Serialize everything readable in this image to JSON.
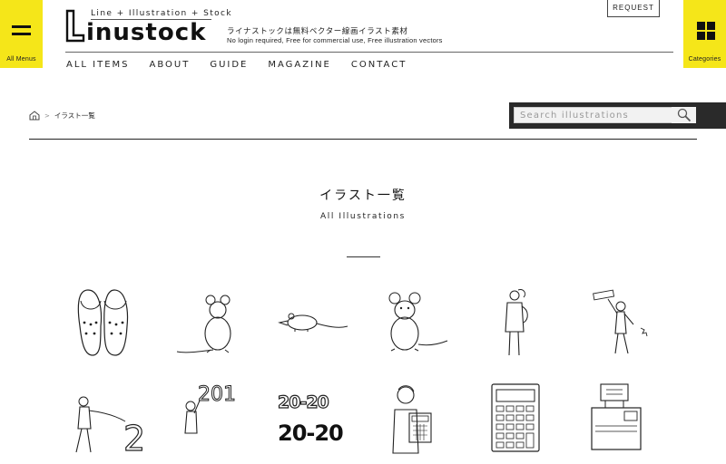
{
  "menus": {
    "left_label": "All Menus",
    "right_label": "Categories"
  },
  "header": {
    "logo_tagline": "Line + Illustration + Stock",
    "logo_word": "inustock",
    "tagline_jp": "ライナストックは無料ベクター線画イラスト素材",
    "tagline_en": "No login required, Free for commercial use, Free illustration vectors",
    "request_label": "REQUEST"
  },
  "nav": {
    "items": [
      "ALL ITEMS",
      "ABOUT",
      "GUIDE",
      "MAGAZINE",
      "CONTACT"
    ]
  },
  "breadcrumb": {
    "separator": ">",
    "current": "イラスト一覧"
  },
  "search": {
    "placeholder": "Search illustrations"
  },
  "main": {
    "title": "イラスト一覧",
    "subtitle": "All Illustrations"
  },
  "thumbnails": {
    "row2_text": {
      "digits_2": "2",
      "year_201": "201",
      "year_top": "20-20",
      "year_bottom": "20-20"
    }
  },
  "colors": {
    "accent_yellow": "#f5e619",
    "search_bar_bg": "#2a2a2a"
  },
  "icons": [
    "hamburger-icon",
    "grid-icon",
    "home-icon",
    "magnifier-icon"
  ]
}
